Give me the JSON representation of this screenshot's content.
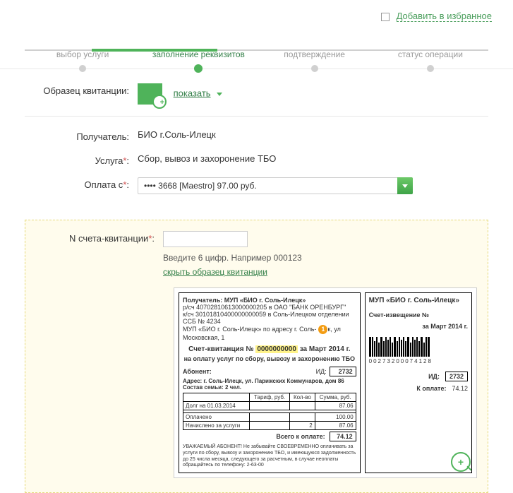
{
  "topLink": {
    "label": "Добавить в избранное"
  },
  "steps": {
    "s1": "выбор услуги",
    "s2": "заполнение реквизитов",
    "s3": "подтверждение",
    "s4": "статус операции"
  },
  "sample": {
    "label": "Образец квитанции:",
    "showLink": "показать"
  },
  "fields": {
    "recipient": {
      "label": "Получатель:",
      "value": "БИО г.Соль-Илецк"
    },
    "service": {
      "label": "Услуга",
      "value": "Сбор, вывоз и захоронение ТБО"
    },
    "payFrom": {
      "label": "Оплата с",
      "value": "•••• 3668 [Maestro] 97.00 руб."
    },
    "account": {
      "label": "N счета-квитанции",
      "helper": "Введите 6 цифр. Например 000123",
      "hideLink": "скрыть образец квитанции"
    }
  },
  "receipt": {
    "left": {
      "recipientLabel": "Получатель:",
      "recipientName": "МУП «БИО г. Соль-Илецк»",
      "line_rs": "р/сч 40702810613000000205 в ОАО \"БАНК ОРЕНБУРГ\"",
      "line_ks": "к/сч 30101810400000000059 в Соль-Илецком отделении ССБ № 4234",
      "line_addr_prefix": "МУП «БИО г. Соль-Илецк» по адресу г. Соль-",
      "line_addr_suffix": "к, ул Московская, 1",
      "badge": "1",
      "titlePrefix": "Счет-квитанция №",
      "titleNumber": "0000000000",
      "titleSuffix": "за Март 2014 г.",
      "subtitle": "на оплату услуг по сбору, вывозу и захоронению ТБО",
      "abonentLabel": "Абонент:",
      "idLabel": "ИД:",
      "idValue": "2732",
      "address": "Адрес: г. Соль-Илецк, ул. Парижских Коммунаров, дом 86",
      "family": "Состав семьи: 2 чел.",
      "table": {
        "headers": [
          "",
          "Тариф, руб.",
          "Кол-во",
          "Сумма, руб."
        ],
        "row1": {
          "label": "Долг на 01.03.2014",
          "sum": "87.06"
        },
        "row2": {
          "label": "Оплачено",
          "sum": "100.00"
        },
        "row3": {
          "label": "Начислено за услуги",
          "qty": "2",
          "sum": "87.06"
        }
      },
      "totalLabel": "Всего к оплате:",
      "totalValue": "74.12",
      "fineText": "УВАЖАЕМЫЙ АБОНЕНТ! Не забывайте СВОЕВРЕМЕННО оплачивать за услуги по сбору, вывозу и захоронению ТБО, и имеющуюся задолженность до 25 числа месяца, следующего за расчетным, в случае неоплаты обращайтесь по телефону: 2-63-00"
    },
    "right": {
      "title": "МУП «БИО г. Соль-Илецк»",
      "sub": "Счет-извещение №",
      "date": "за Март 2014 г.",
      "barcodeNum": "00273200074128",
      "idLabel": "ИД:",
      "idValue": "2732",
      "payLabel": "К оплате:",
      "payValue": "74.12"
    }
  }
}
